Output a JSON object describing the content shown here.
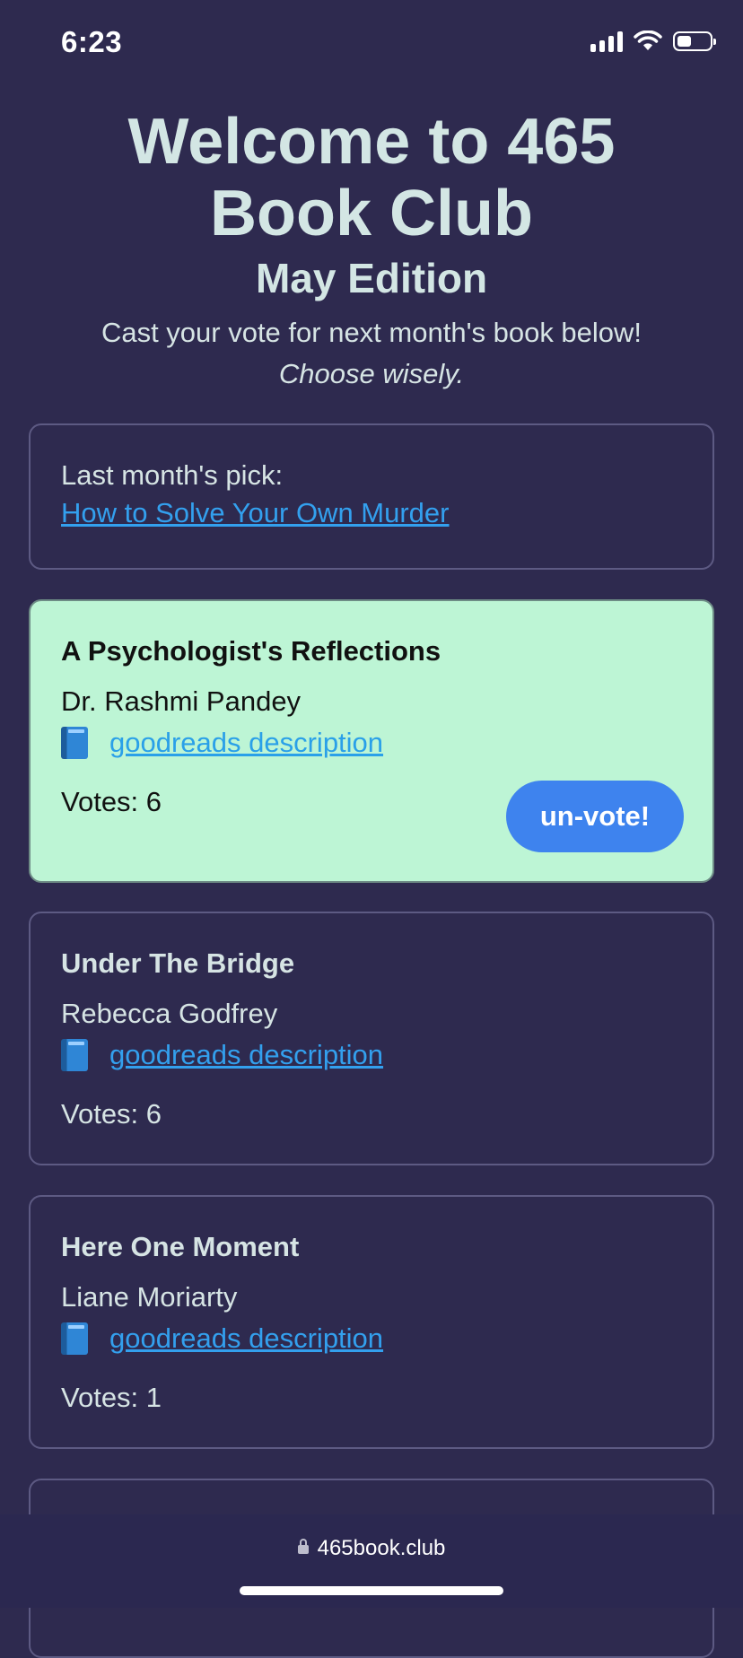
{
  "status_bar": {
    "time": "6:23",
    "signal_bars": 4,
    "battery_level": 0.45
  },
  "header": {
    "title": "Welcome to 465 Book Club",
    "subtitle": "May Edition",
    "tagline": "Cast your vote for next month's book below!",
    "tagline_emphasis": "Choose wisely."
  },
  "last_month": {
    "label": "Last month's pick:",
    "link_text": "How to Solve Your Own Murder"
  },
  "books": [
    {
      "title": "A Psychologist's Reflections",
      "author": "Dr. Rashmi Pandey",
      "link_text": "goodreads description",
      "votes_text": "Votes: 6",
      "voted": true,
      "button_label": "un-vote!"
    },
    {
      "title": "Under The Bridge",
      "author": "Rebecca Godfrey",
      "link_text": "goodreads description",
      "votes_text": "Votes: 6",
      "voted": false
    },
    {
      "title": "Here One Moment",
      "author": "Liane Moriarty",
      "link_text": "goodreads description",
      "votes_text": "Votes: 1",
      "voted": false
    }
  ],
  "browser": {
    "url": "465book.club"
  },
  "colors": {
    "background": "#2e2a4f",
    "selected_card": "#bdf5d5",
    "link": "#33a0ee",
    "button": "#3e83ee"
  },
  "icons": [
    "signal-icon",
    "wifi-icon",
    "battery-icon",
    "book-icon",
    "lock-icon"
  ]
}
